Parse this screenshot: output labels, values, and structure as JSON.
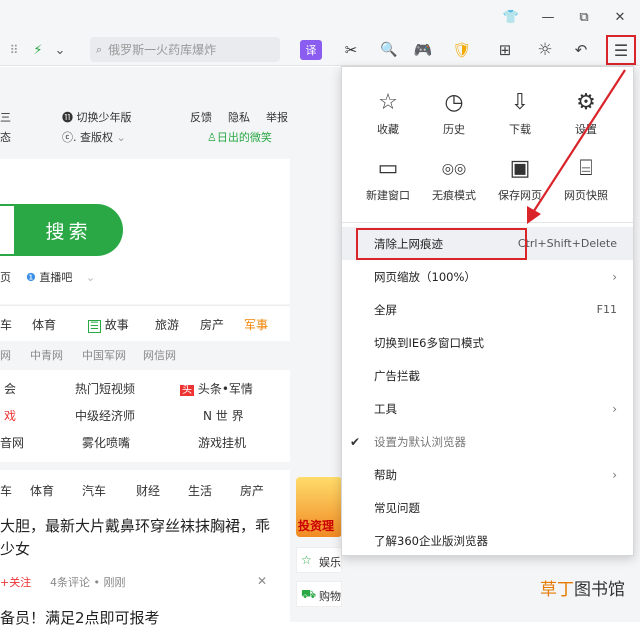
{
  "window_controls": {
    "skin_icon": "👕",
    "minimize": "—",
    "restore": "⧉",
    "close": "✕"
  },
  "toolbar": {
    "grid_icon": "⠿",
    "lightning": "⚡",
    "dropdown": "⌄",
    "search_placeholder": "俄罗斯一火药库爆炸",
    "translate": "译",
    "scissors": "✂",
    "find": "🔍",
    "game": "🎮",
    "shield": "🛡",
    "apps": "⊞",
    "brightness": "☼",
    "undo": "↶",
    "menu": "☰"
  },
  "page": {
    "top_links": {
      "left1": "三",
      "left2": "态",
      "young": "切换少年版",
      "rights": "查版权",
      "feedback": "反馈",
      "privacy": "隐私",
      "report": "举报",
      "weibo": "日出的微笑"
    },
    "search_btn": "搜索",
    "sub_links": {
      "page": "页",
      "live": "直播吧"
    },
    "nav_tabs": [
      "车",
      "体育",
      "故事",
      "旅游",
      "房产",
      "军事"
    ],
    "news_sites": [
      "网",
      "中青网",
      "中国军网",
      "网信网"
    ],
    "hot": {
      "r1": [
        "会",
        "热门短视频",
        "头条•军情"
      ],
      "r2": [
        "戏",
        "中级经济师",
        "N 世 界"
      ],
      "r3": [
        "音网",
        "雾化喷嘴",
        "游戏挂机"
      ]
    },
    "feed_tabs": [
      "车",
      "体育",
      "汽车",
      "财经",
      "生活",
      "房产"
    ],
    "headline1": "大胆，最新大片戴鼻环穿丝袜抹胸裙，乖",
    "headline2": "少女",
    "follow": "+关注",
    "comments": "4条评论 • 刚刚",
    "headline3": "备员！满足2点即可报考",
    "side_ad": "投资理",
    "side1": "娱乐",
    "side2": "购物"
  },
  "menu": {
    "quick": [
      {
        "icon": "☆",
        "label": "收藏"
      },
      {
        "icon": "◷",
        "label": "历史"
      },
      {
        "icon": "⇩",
        "label": "下载"
      },
      {
        "icon": "⚙",
        "label": "设置"
      },
      {
        "icon": "▭",
        "label": "新建窗口"
      },
      {
        "icon": "◎◎",
        "label": "无痕模式"
      },
      {
        "icon": "▣",
        "label": "保存网页"
      },
      {
        "icon": "⌸",
        "label": "网页快照"
      }
    ],
    "items": [
      {
        "label": "清除上网痕迹",
        "shortcut": "Ctrl+Shift+Delete"
      },
      {
        "label": "网页缩放（100%）",
        "arrow": "›"
      },
      {
        "label": "全屏",
        "shortcut": "F11"
      },
      {
        "label": "切换到IE6多窗口模式"
      },
      {
        "label": "广告拦截"
      },
      {
        "label": "工具",
        "arrow": "›"
      },
      {
        "label": "设置为默认浏览器",
        "check": "✔"
      },
      {
        "label": "帮助",
        "arrow": "›"
      },
      {
        "label": "常见问题"
      },
      {
        "label": "了解360企业版浏览器"
      }
    ]
  },
  "watermark": {
    "a": "草丁",
    "b": "图书馆"
  },
  "colors": {
    "accent_green": "#2aa845",
    "highlight_red": "#d9242a"
  }
}
